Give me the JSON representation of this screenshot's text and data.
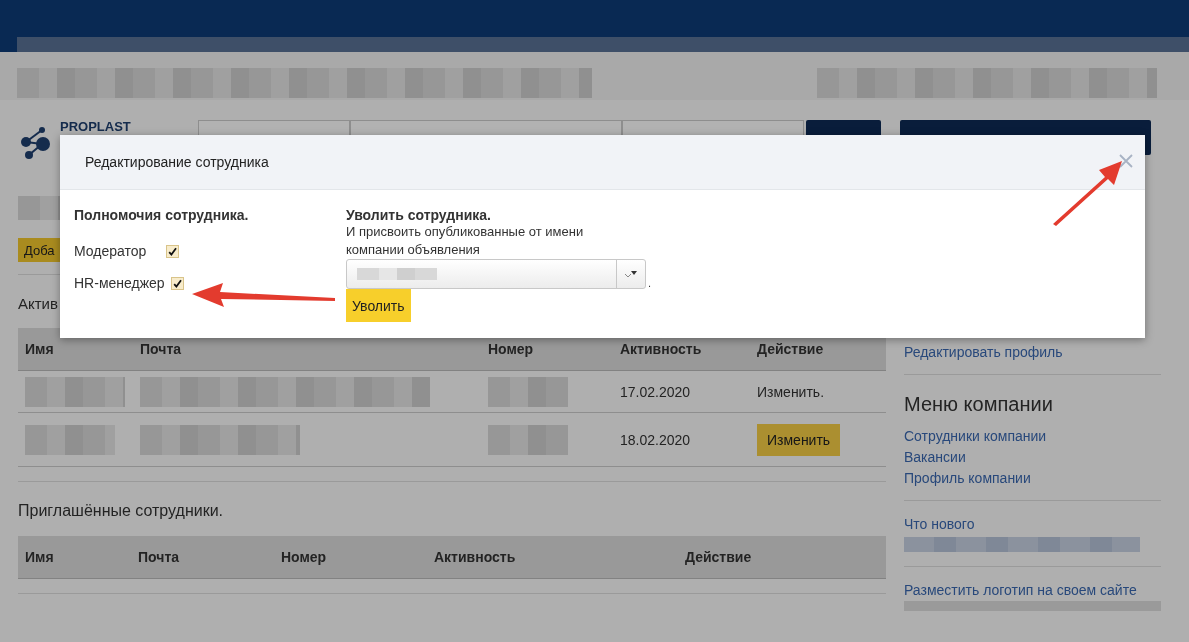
{
  "site": {
    "logo_text": "PROPLAST"
  },
  "left": {
    "add_button": "Доба",
    "active_heading": "Актив",
    "active_table": {
      "columns": [
        "Имя",
        "Почта",
        "Номер",
        "Активность",
        "Действие"
      ],
      "rows": [
        {
          "activity": "17.02.2020",
          "action": {
            "kind": "link",
            "label": "Изменить."
          }
        },
        {
          "activity": "18.02.2020",
          "action": {
            "kind": "button",
            "label": "Изменить"
          }
        }
      ]
    },
    "invited_heading": "Приглашённые сотрудники.",
    "invited_table": {
      "columns": [
        "Имя",
        "Почта",
        "Номер",
        "Активность",
        "Действие"
      ]
    }
  },
  "sidebar": {
    "profile_link": "Редактировать профиль",
    "menu_heading": "Меню компании",
    "menu_links": [
      "Сотрудники компании",
      "Вакансии",
      "Профиль компании"
    ],
    "news_label": "Что нового",
    "logo_link": "Разместить логотип на своем сайте"
  },
  "modal": {
    "title": "Редактирование сотрудника",
    "permissions": {
      "heading": "Полномочия сотрудника.",
      "items": [
        {
          "label": "Модератор",
          "checked": true
        },
        {
          "label": "HR-менеджер",
          "checked": true
        }
      ]
    },
    "dismiss": {
      "heading": "Уволить сотрудника.",
      "note": "И присвоить опубликованные от имени компании объявления",
      "select_suffix": ".",
      "button": "Уволить"
    }
  }
}
